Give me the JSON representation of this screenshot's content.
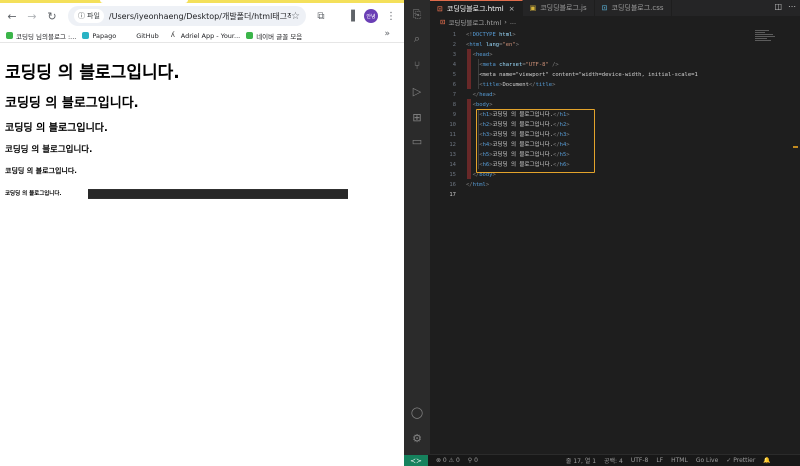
{
  "browser": {
    "omnibox": {
      "chip_label": "파일",
      "url": "/Users/iyeonhaeng/Desktop/개발폴더/html태그적..."
    },
    "avatar_label": "안녕",
    "bookmarks": [
      {
        "label": "코딩딩 님의블로그 :..."
      },
      {
        "label": "Papago"
      },
      {
        "label": "GitHub"
      },
      {
        "label": "Adriel App - Your..."
      },
      {
        "label": "네이버 글꼴 모음"
      }
    ],
    "bookmarks_more": "»",
    "headings": {
      "h1": "코딩딩 의 블로그입니다.",
      "h2": "코딩딩 의 블로그입니다.",
      "h3": "코딩딩 의 블로그입니다.",
      "h4": "코딩딩 의 블로그입니다.",
      "h5": "코딩딩 의 블로그입니다.",
      "h6": "코딩딩 의 블로그입니다."
    }
  },
  "editor": {
    "tabs": [
      {
        "label": "코딩딩블로그.html",
        "icon": "html-file-icon",
        "active": true
      },
      {
        "label": "코딩딩블로그.js",
        "icon": "js-file-icon",
        "active": false
      },
      {
        "label": "코딩딩블로그.css",
        "icon": "css-file-icon",
        "active": false
      }
    ],
    "breadcrumb": {
      "file": "코딩딩블로그.html",
      "sep": "›",
      "node": "..."
    },
    "line_numbers": [
      "1",
      "2",
      "3",
      "4",
      "5",
      "6",
      "7",
      "8",
      "9",
      "10",
      "11",
      "12",
      "13",
      "14",
      "15",
      "16",
      "17"
    ],
    "code_lines": [
      "<!DOCTYPE html>",
      "<html lang=\"en\">",
      "  <head>",
      "    <meta charset=\"UTF-8\" />",
      "    <meta name=\"viewport\" content=\"width=device-width, initial-scale=1",
      "    <title>Document</title>",
      "  </head>",
      "  <body>",
      "    <h1>코딩딩 의 블로그입니다.</h1>",
      "    <h2>코딩딩 의 블로그입니다.</h2>",
      "    <h3>코딩딩 의 블로그입니다.</h3>",
      "    <h4>코딩딩 의 블로그입니다.</h4>",
      "    <h5>코딩딩 의 블로그입니다.</h5>",
      "    <h6>코딩딩 의 블로그입니다.</h6>",
      "  </body>",
      "</html>",
      ""
    ]
  },
  "statusbar": {
    "errors": "⊗ 0 ⚠ 0",
    "ports": "⚲ 0",
    "position": "줄 17, 열 1",
    "spaces": "공백: 4",
    "encoding": "UTF-8",
    "eol": "LF",
    "language": "HTML",
    "golive": "Go Live",
    "prettier": "✓ Prettier",
    "bell": "🔔"
  },
  "colors": {
    "highlight_box": "#e3a32b",
    "tag": "#569cd6",
    "attribute": "#9cdcfe",
    "string": "#ce9178",
    "remote_indicator": "#16825d"
  }
}
